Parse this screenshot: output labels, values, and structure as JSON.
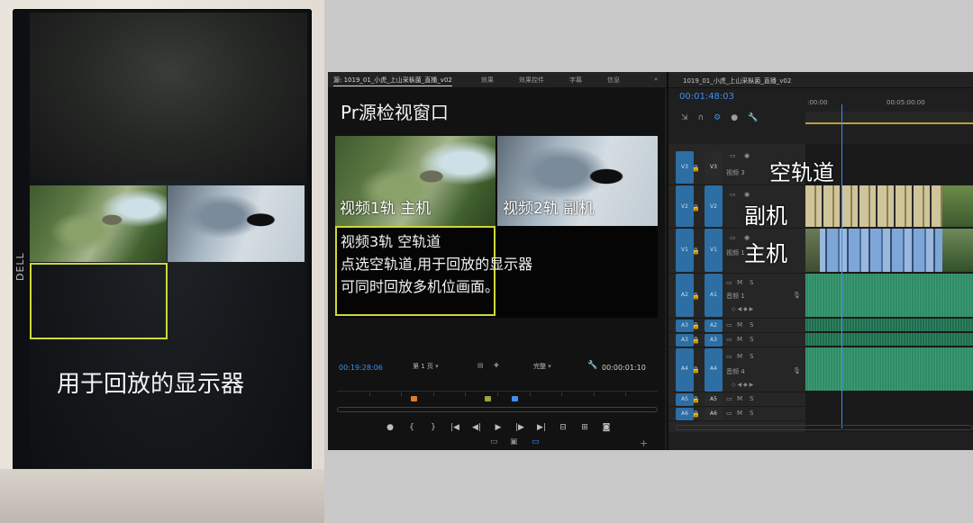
{
  "photo": {
    "brand": "DELL",
    "caption": "用于回放的显示器",
    "highlight_color": "#cdd83a"
  },
  "premiere": {
    "panel_tabs": [
      "源: 1019_01_小虎_上山采枞菌_直播_v02",
      "效果",
      "效果控件",
      "字幕",
      "信息",
      "»"
    ],
    "source_monitor": {
      "overlay_title": "Pr源检视窗口",
      "frame1_label": "视频1轨 主机",
      "frame2_label": "视频2轨 副机",
      "desc_lines": [
        "视频3轨 空轨道",
        "点选空轨道,用于回放的显示器",
        "可同时回放多机位画面。"
      ],
      "timecode_in": "00:19:28:06",
      "page_select": "第 1 页",
      "quality_select": "完整",
      "timecode_duration": "00:00:01:10",
      "wrench_icon": "wrench-icon"
    },
    "timeline": {
      "tab_label": "1019_01_小虎_上山采枞菌_直播_v02",
      "timecode": "00:01:48:03",
      "ruler_labels": [
        ":00:00",
        "00:05:00:00"
      ],
      "tracks": [
        {
          "patch": "V3",
          "target": "V3",
          "name": "视频 3"
        },
        {
          "patch": "V2",
          "target": "V2",
          "name": ""
        },
        {
          "patch": "V1",
          "target": "V1",
          "name": "视频 1"
        },
        {
          "patch": "A2",
          "target": "A1",
          "name": "音频 1"
        },
        {
          "patch": "A3",
          "target": "A2",
          "name": ""
        },
        {
          "patch": "A3",
          "target": "A3",
          "name": ""
        },
        {
          "patch": "A4",
          "target": "A4",
          "name": "音频 4"
        },
        {
          "patch": "A5",
          "target": "A5",
          "name": ""
        },
        {
          "patch": "A6",
          "target": "A6",
          "name": ""
        }
      ],
      "track_toggles": [
        "M",
        "S"
      ],
      "overlay_empty_track": "空轨道",
      "overlay_secondary": "副机",
      "overlay_primary": "主机"
    }
  },
  "colors": {
    "highlight": "#cdd83a",
    "timecode_blue": "#3f8ef0",
    "video_clip_blue": "#7ea6d8",
    "audio_clip_green": "#2e8b66"
  }
}
